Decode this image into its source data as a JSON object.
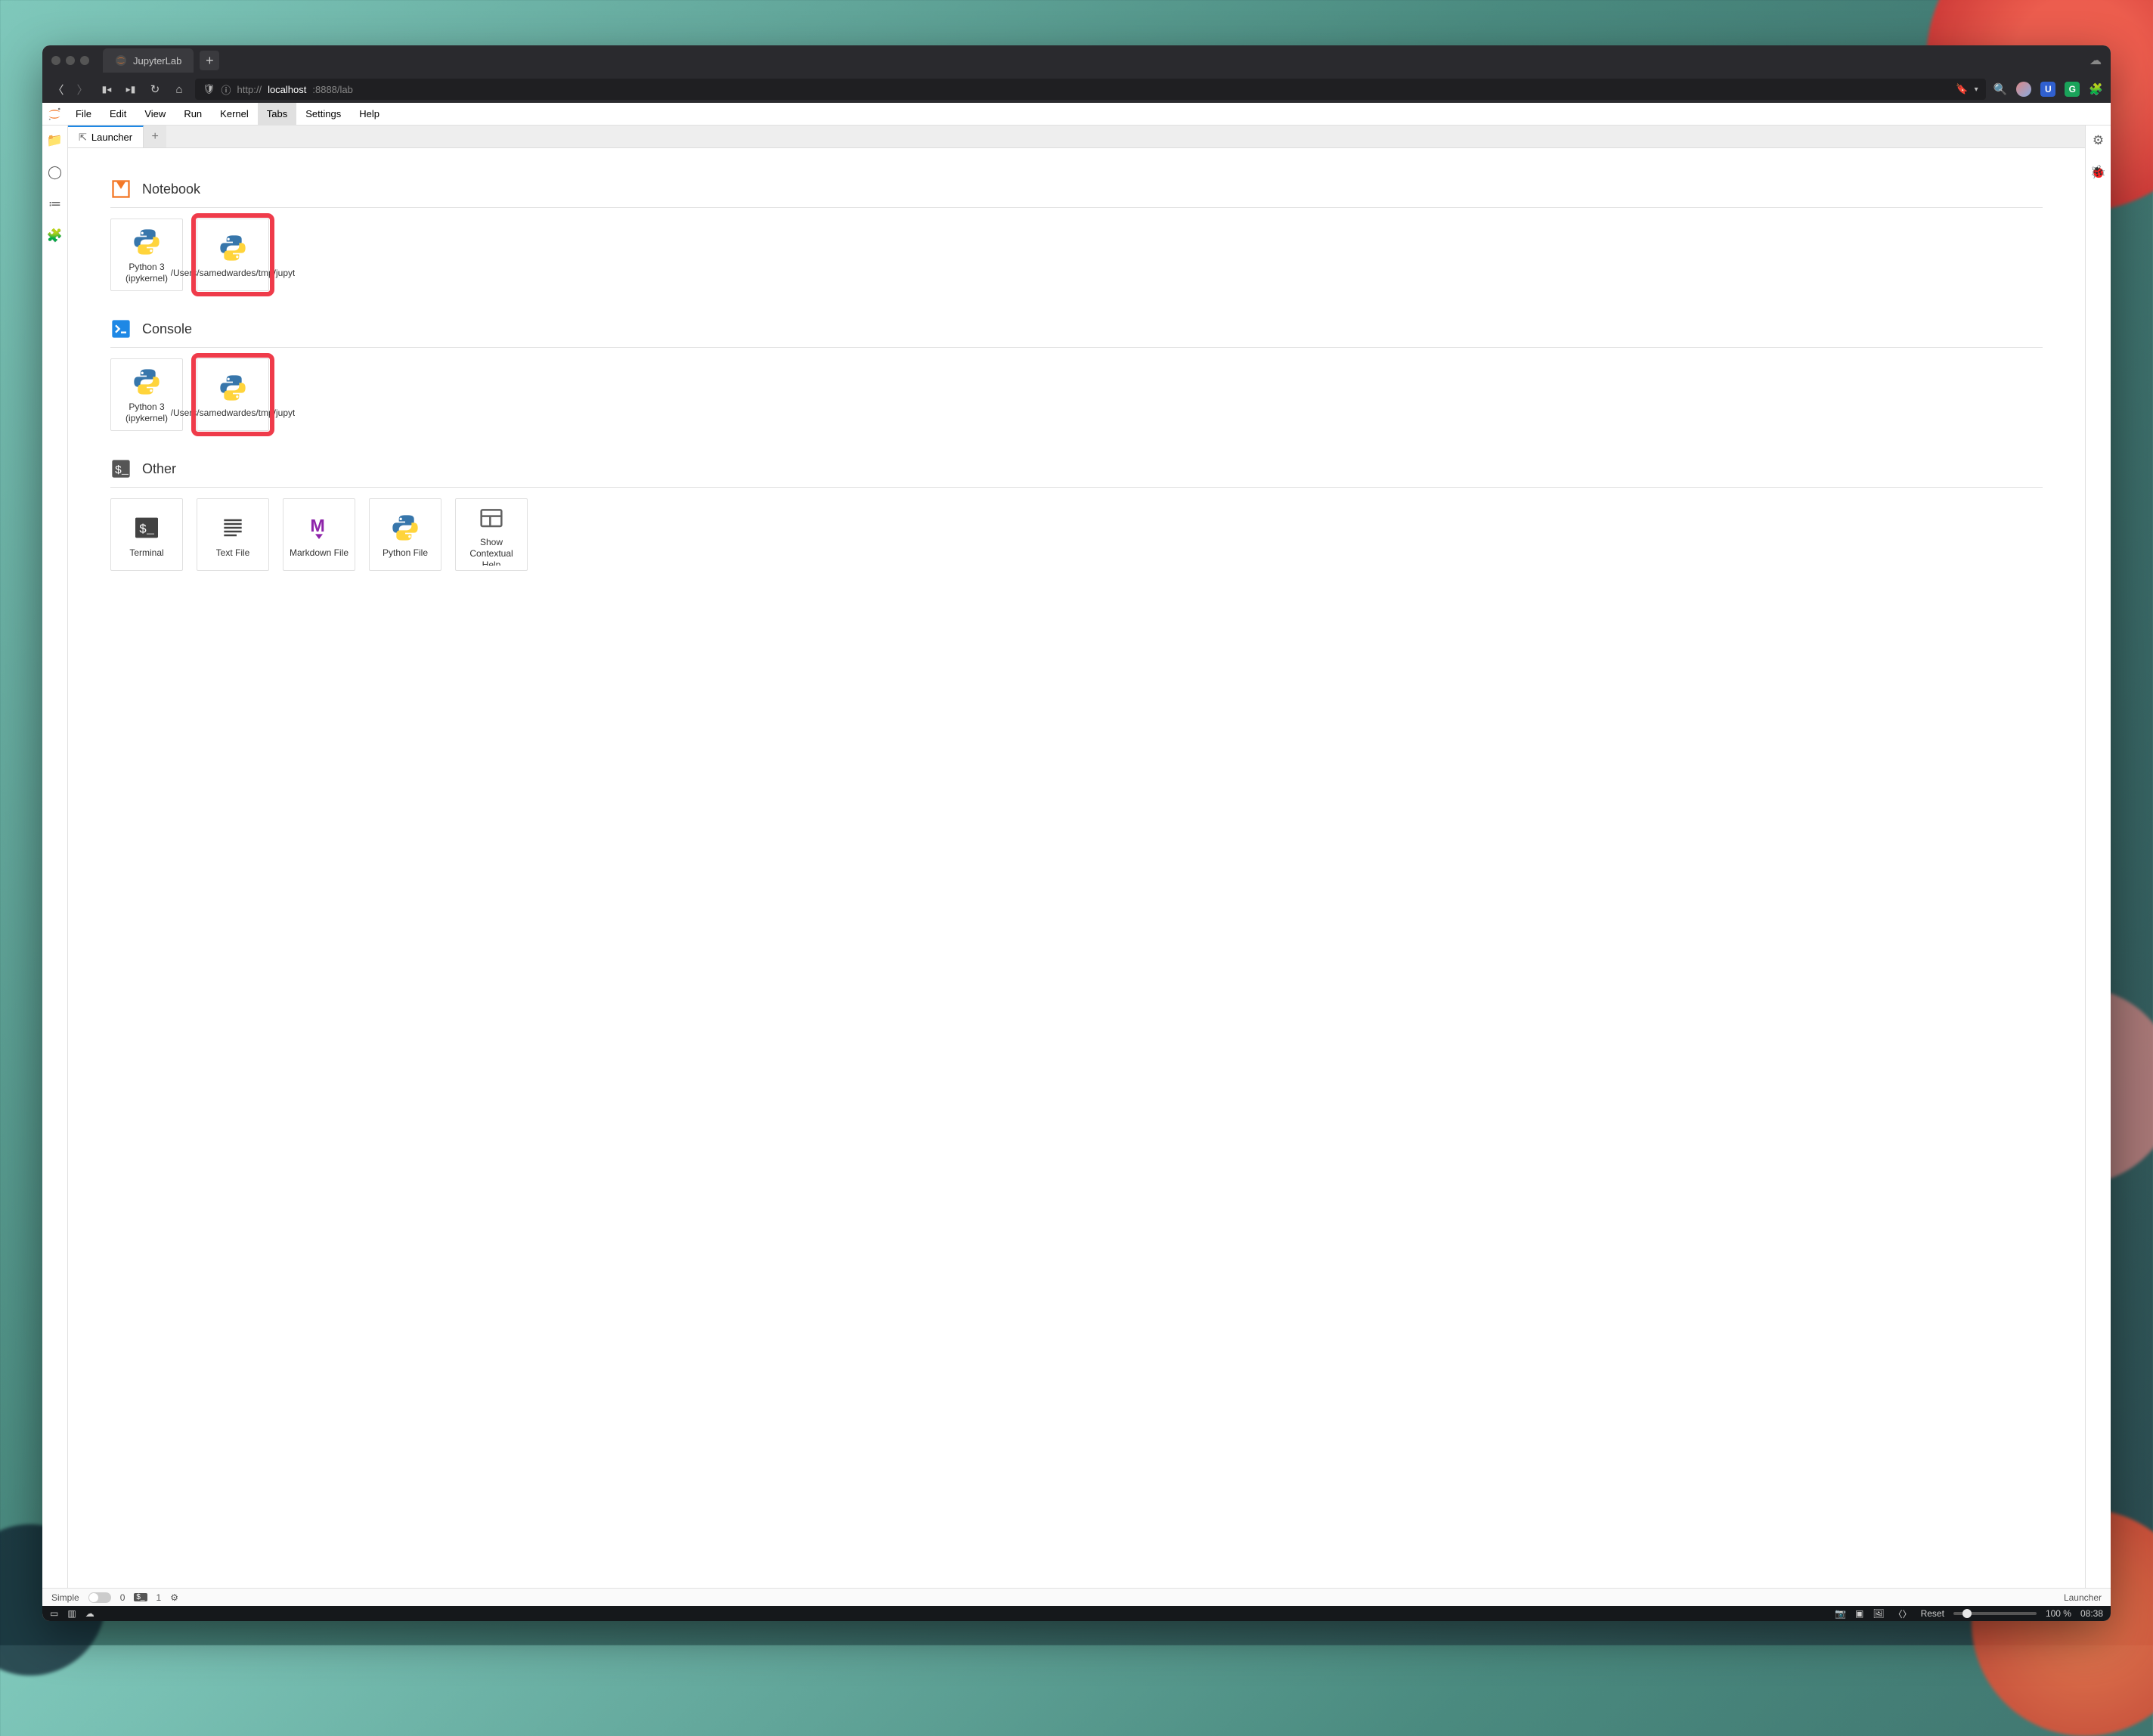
{
  "browser": {
    "tab_title": "JupyterLab",
    "url_proto": "http://",
    "url_host": "localhost",
    "url_rest": ":8888/lab"
  },
  "menubar": {
    "items": [
      "File",
      "Edit",
      "View",
      "Run",
      "Kernel",
      "Tabs",
      "Settings",
      "Help"
    ],
    "active_index": 5
  },
  "doctab": {
    "label": "Launcher"
  },
  "sections": {
    "notebook": {
      "title": "Notebook",
      "cards": [
        {
          "label": "Python 3 (ipykernel)",
          "highlight": false
        },
        {
          "label": "/Users/samedwardes/tmp/jupyt",
          "highlight": true
        }
      ]
    },
    "console": {
      "title": "Console",
      "cards": [
        {
          "label": "Python 3 (ipykernel)",
          "highlight": false
        },
        {
          "label": "/Users/samedwardes/tmp/jupyt",
          "highlight": true
        }
      ]
    },
    "other": {
      "title": "Other",
      "cards": [
        {
          "label": "Terminal",
          "icon": "terminal"
        },
        {
          "label": "Text File",
          "icon": "text"
        },
        {
          "label": "Markdown File",
          "icon": "markdown"
        },
        {
          "label": "Python File",
          "icon": "python"
        },
        {
          "label": "Show Contextual Help",
          "icon": "help"
        }
      ]
    }
  },
  "statusbar": {
    "simple_label": "Simple",
    "kernel_count": "0",
    "terminal_count": "1",
    "right_label": "Launcher"
  },
  "osbar": {
    "reset_label": "Reset",
    "zoom_label": "100 %",
    "time": "08:38"
  }
}
